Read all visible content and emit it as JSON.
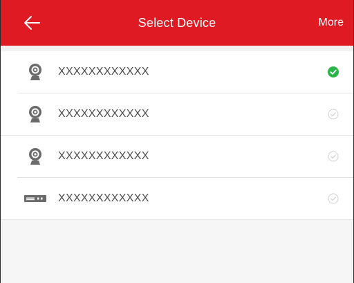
{
  "header": {
    "back_icon": "arrow-left-icon",
    "title": "Select Device",
    "more_label": "More"
  },
  "colors": {
    "header_bg": "#e01a22",
    "selected_check": "#2bb449",
    "unselected_check": "#cfcfcf",
    "device_icon": "#6b6b6b"
  },
  "devices": [
    {
      "name": "XXXXXXXXXXXX",
      "icon": "camera-icon",
      "selected": true
    },
    {
      "name": "XXXXXXXXXXXX",
      "icon": "camera-icon",
      "selected": false
    },
    {
      "name": "XXXXXXXXXXXX",
      "icon": "camera-icon",
      "selected": false
    },
    {
      "name": "XXXXXXXXXXXX",
      "icon": "dvr-icon",
      "selected": false
    }
  ]
}
